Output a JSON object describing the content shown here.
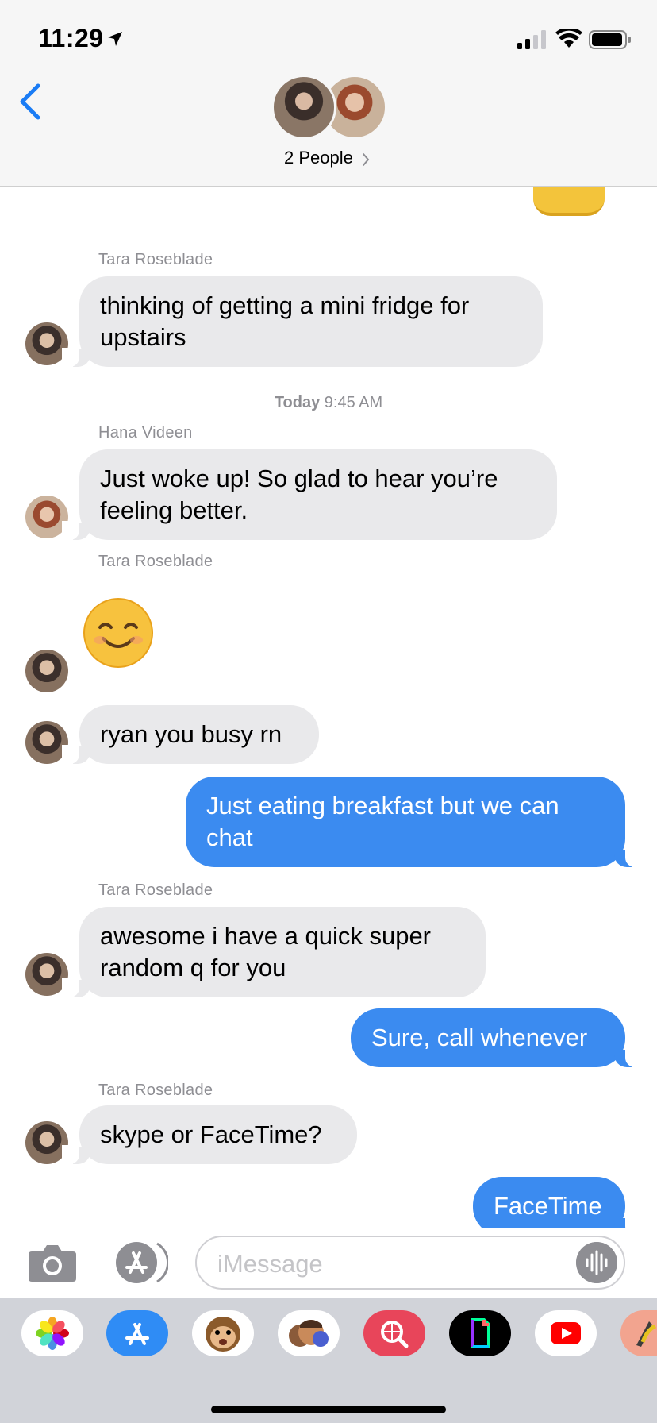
{
  "status_bar": {
    "time": "11:29"
  },
  "header": {
    "people_label": "2 People"
  },
  "messages": {
    "m1": {
      "sender": "Tara Roseblade",
      "text": "thinking of getting a mini fridge for upstairs"
    },
    "timestamp": {
      "day": "Today",
      "time": "9:45 AM"
    },
    "m2": {
      "sender": "Hana Videen",
      "text": "Just woke up! So glad to hear you’re feeling better."
    },
    "m3": {
      "sender": "Tara Roseblade"
    },
    "m4": {
      "text": "ryan you busy rn"
    },
    "m5": {
      "text": "Just eating breakfast but we can chat"
    },
    "m6": {
      "sender": "Tara Roseblade",
      "text": "awesome i have a quick super random q for you"
    },
    "m7": {
      "text": "Sure, call whenever"
    },
    "m8": {
      "sender": "Tara Roseblade",
      "text": "skype or FaceTime?"
    },
    "m9": {
      "text": "FaceTime"
    }
  },
  "input": {
    "placeholder": "iMessage"
  },
  "app_drawer": [
    "photos-icon",
    "app-store-icon",
    "animoji-icon",
    "memoji-stickers-icon",
    "web-search-icon",
    "gif-icon",
    "youtube-icon",
    "music-app-icon"
  ],
  "colors": {
    "outgoing_bubble": "#3b8bf0",
    "incoming_bubble": "#e9e9eb",
    "accent": "#1a7cf5"
  }
}
